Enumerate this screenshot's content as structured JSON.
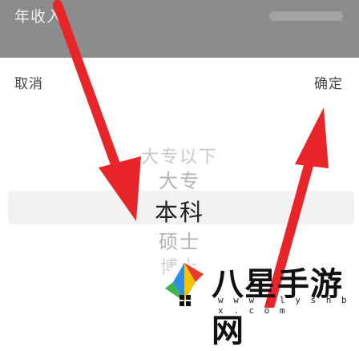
{
  "form": {
    "label": "年收入"
  },
  "sheet": {
    "cancel_label": "取消",
    "confirm_label": "确定"
  },
  "picker": {
    "options": [
      "大专以下",
      "大专",
      "本科",
      "硕士",
      "博士"
    ],
    "selected": "本科"
  },
  "watermark": {
    "brand": "八星手游网",
    "url": "w w w . l y s h b x . c o m"
  },
  "colors": {
    "arrow": "#e8262a",
    "overlay": "#8c8c8c",
    "selection": "#f2f2f2"
  }
}
